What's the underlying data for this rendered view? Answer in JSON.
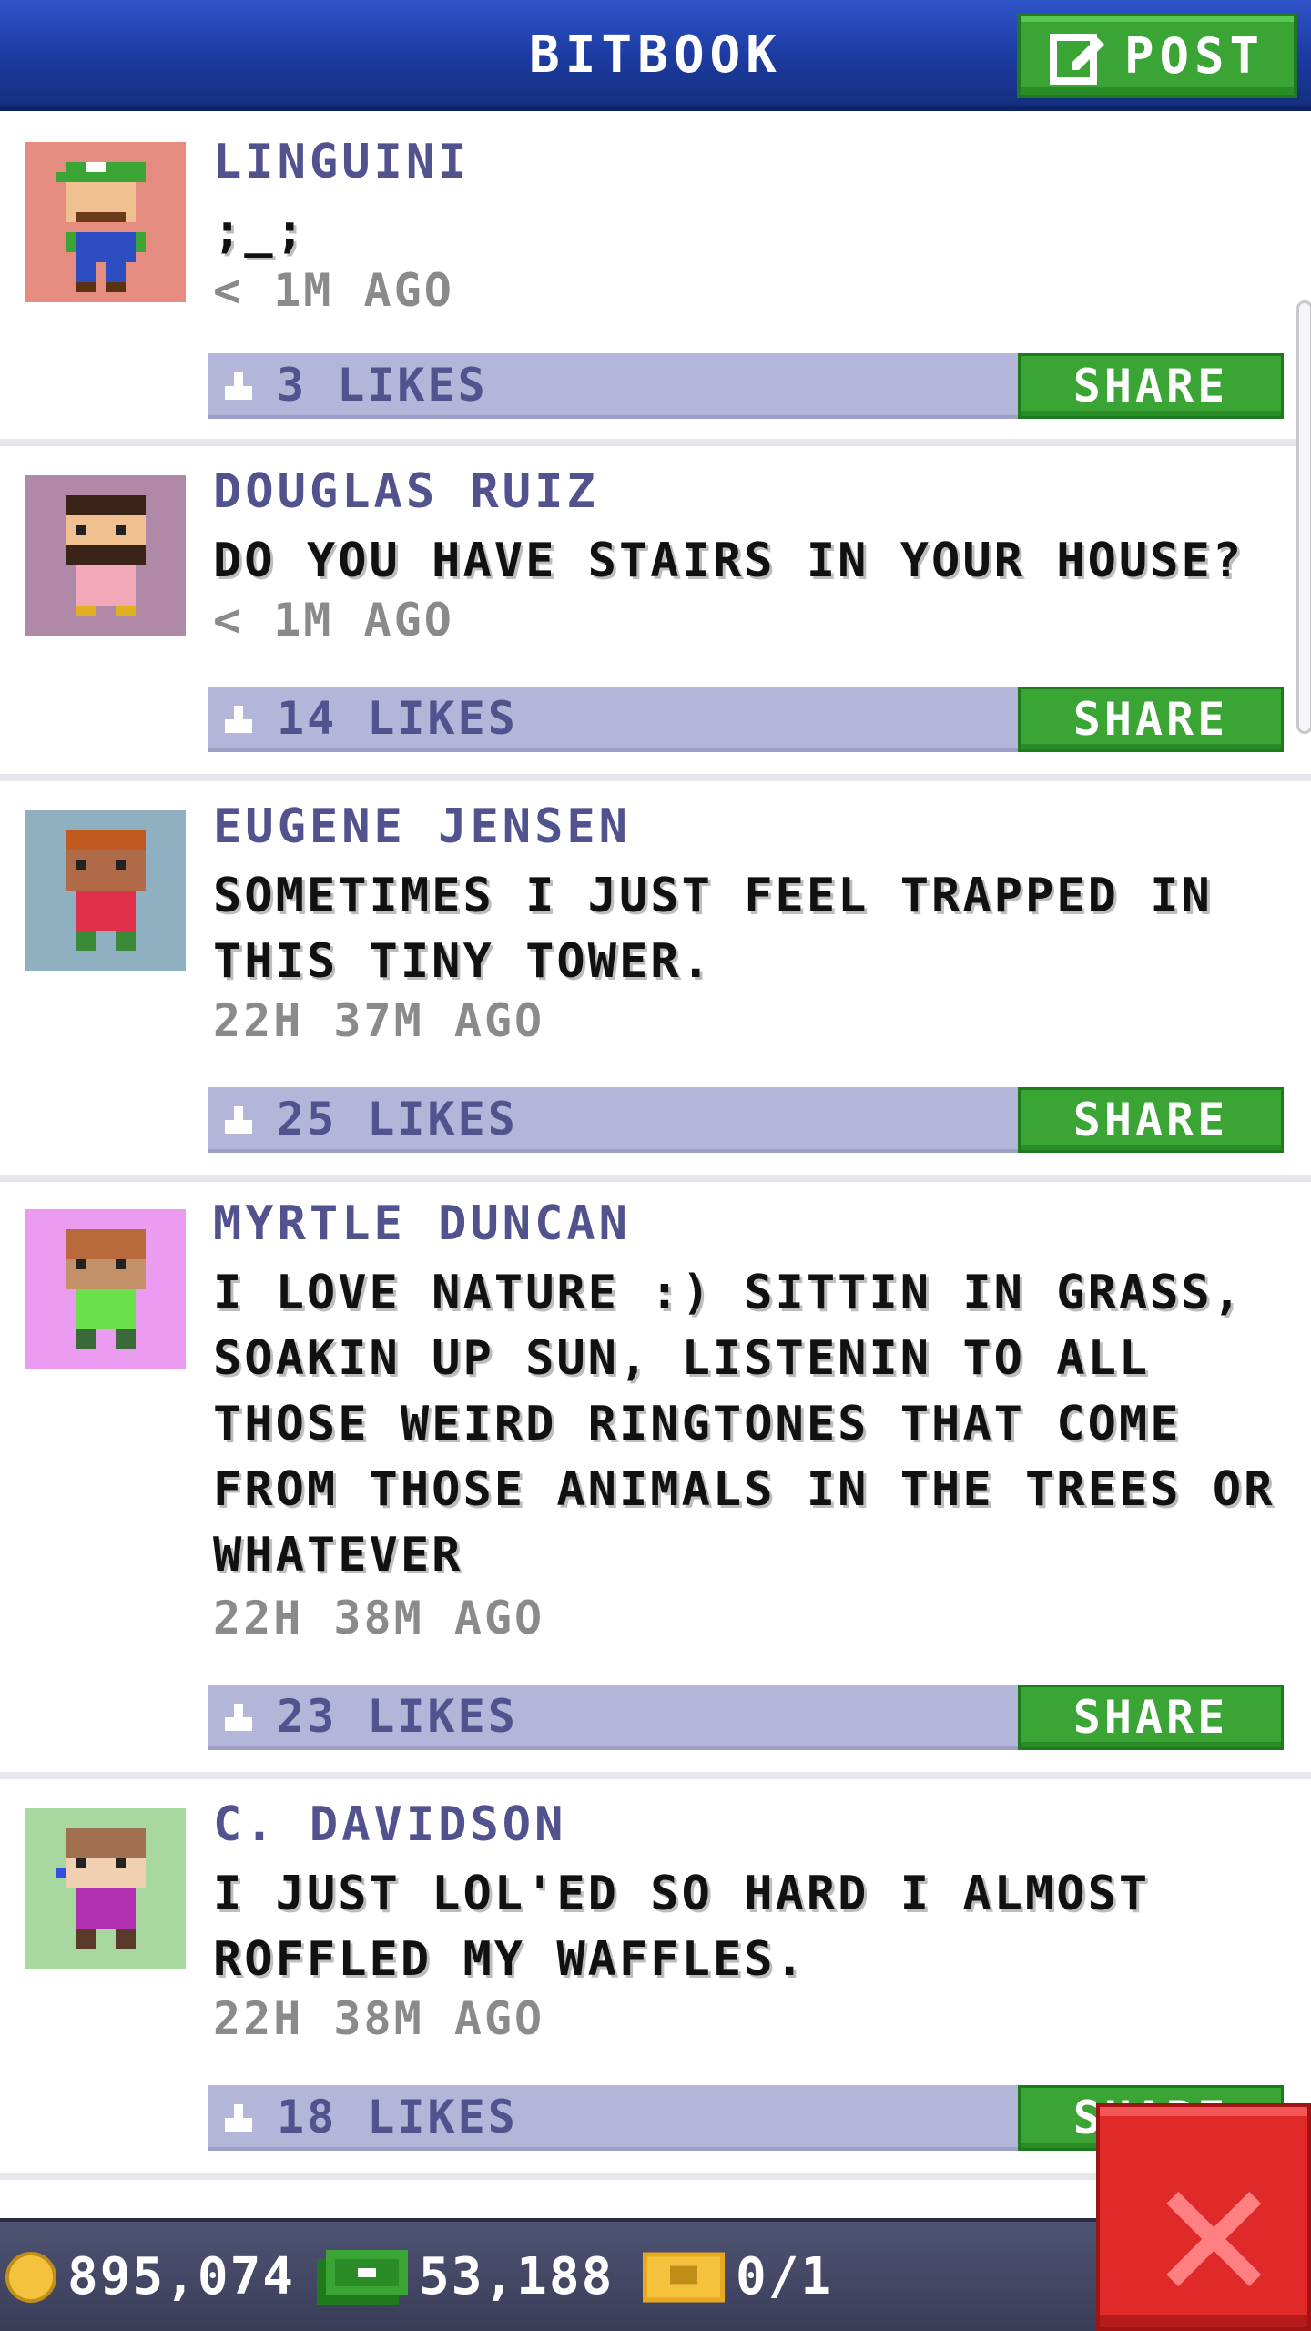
{
  "header": {
    "title": "BITBOOK",
    "post_label": "POST"
  },
  "posts": [
    {
      "author": "LINGUINI",
      "message": ";_;",
      "time": "< 1M AGO",
      "likes": "3 LIKES",
      "share_label": "SHARE",
      "avatar_bg": "#e48c80"
    },
    {
      "author": "DOUGLAS RUIZ",
      "message": "DO YOU HAVE STAIRS IN YOUR HOUSE?",
      "time": "< 1M AGO",
      "likes": "14 LIKES",
      "share_label": "SHARE",
      "avatar_bg": "#b088a8"
    },
    {
      "author": "EUGENE JENSEN",
      "message": "SOMETIMES I JUST FEEL TRAPPED IN THIS TINY TOWER.",
      "time": "22H 37M AGO",
      "likes": "25 LIKES",
      "share_label": "SHARE",
      "avatar_bg": "#8fb0c0"
    },
    {
      "author": "MYRTLE DUNCAN",
      "message": "I LOVE NATURE :) SITTIN IN GRASS, SOAKIN UP SUN, LISTENIN TO ALL THOSE WEIRD RINGTONES THAT COME FROM THOSE ANIMALS IN THE TREES OR WHATEVER",
      "time": "22H 38M AGO",
      "likes": "23 LIKES",
      "share_label": "SHARE",
      "avatar_bg": "#ec9cf0"
    },
    {
      "author": "C. DAVIDSON",
      "message": "I JUST LOL'ED SO HARD I ALMOST ROFFLED MY WAFFLES.",
      "time": "22H 38M AGO",
      "likes": "18 LIKES",
      "share_label": "SHARE",
      "avatar_bg": "#a8d8a0"
    }
  ],
  "status_bar": {
    "coins": "895,074",
    "bux": "53,188",
    "tickets": "0/1"
  },
  "colors": {
    "header_blue": "#1c3aa0",
    "share_green": "#3aa535",
    "name_purple": "#52528e",
    "likes_bar": "#b3b6d8",
    "close_red": "#e02a2a"
  }
}
